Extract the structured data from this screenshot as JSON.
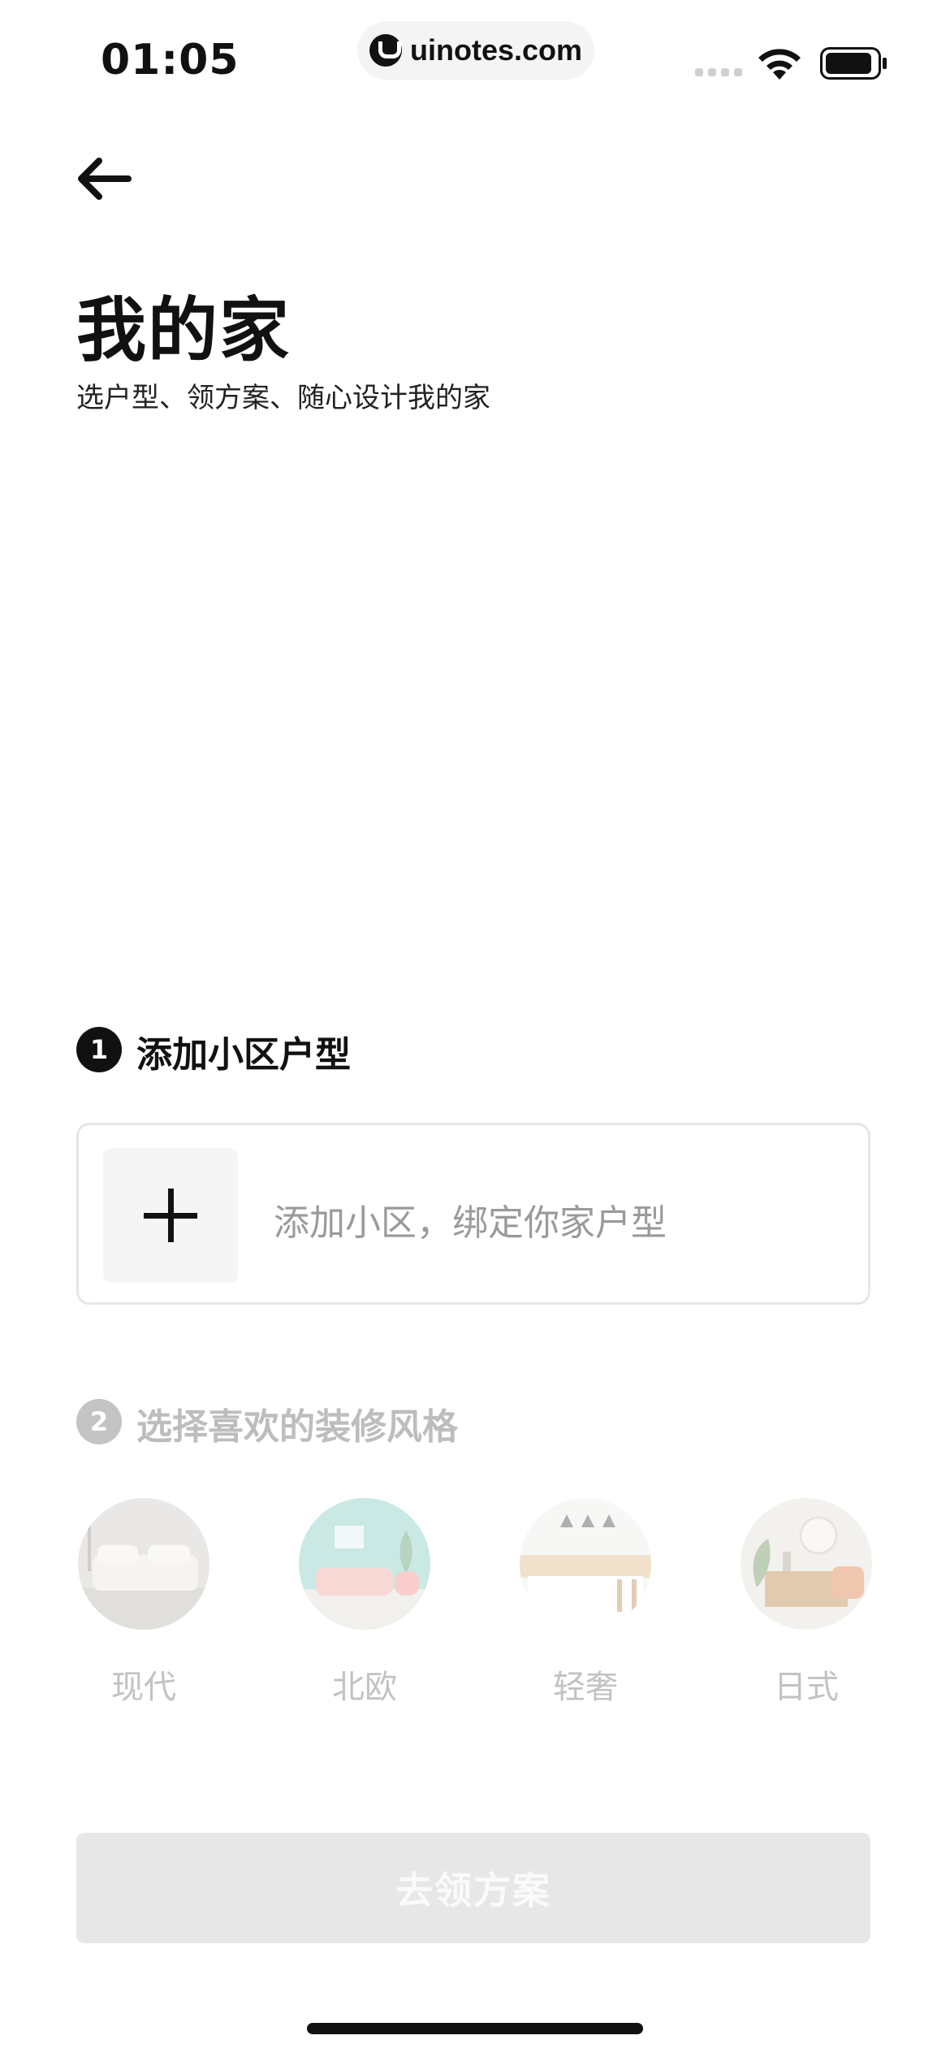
{
  "status_bar": {
    "time": "01:05",
    "url": "uinotes.com"
  },
  "header": {
    "title": "我的家",
    "subtitle": "选户型、领方案、随心设计我的家"
  },
  "step1": {
    "number": "1",
    "label": "添加小区户型",
    "add_card_text": "添加小区，绑定你家户型"
  },
  "step2": {
    "number": "2",
    "label": "选择喜欢的装修风格",
    "styles": [
      {
        "label": "现代",
        "icon": "modern-room-thumbnail"
      },
      {
        "label": "北欧",
        "icon": "nordic-room-thumbnail"
      },
      {
        "label": "轻奢",
        "icon": "light-luxury-room-thumbnail"
      },
      {
        "label": "日式",
        "icon": "japanese-room-thumbnail"
      }
    ]
  },
  "cta": {
    "label": "去领方案"
  },
  "colors": {
    "primary_text": "#111111",
    "disabled_text": "#bdbdbd",
    "button_disabled_bg": "#e7e7e7"
  }
}
